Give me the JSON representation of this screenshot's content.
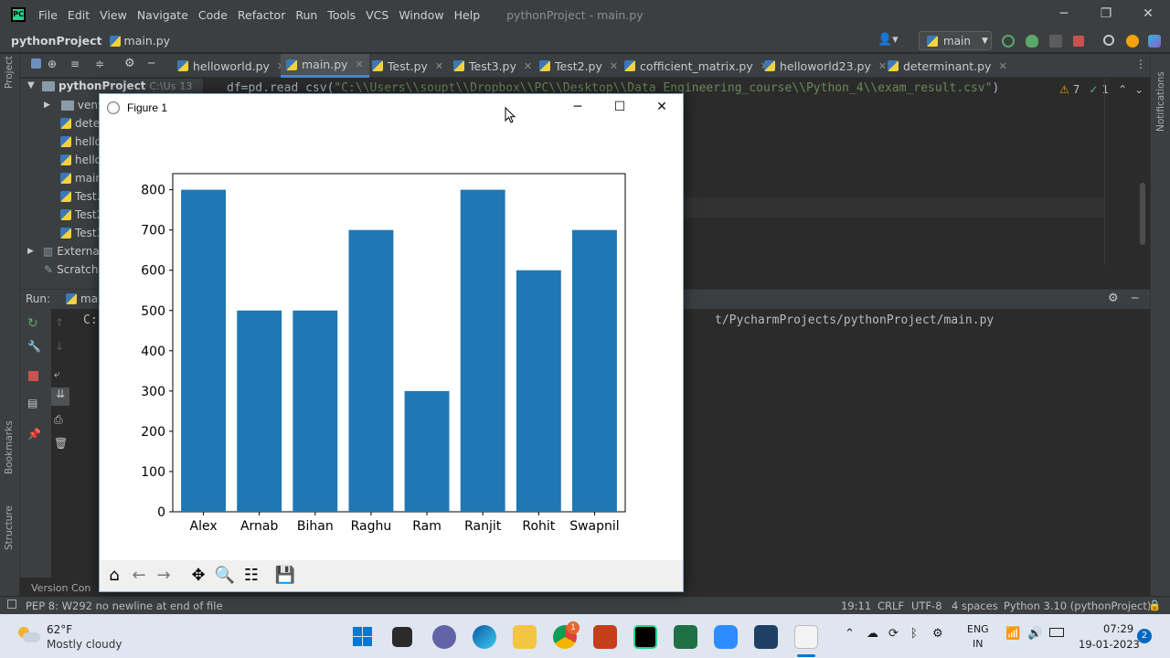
{
  "menubar": {
    "items": [
      "File",
      "Edit",
      "View",
      "Navigate",
      "Code",
      "Refactor",
      "Run",
      "Tools",
      "VCS",
      "Window",
      "Help"
    ],
    "window_title": "pythonProject - main.py"
  },
  "navbar": {
    "project": "pythonProject",
    "file": "main.py",
    "run_config": "main"
  },
  "tabs": [
    "helloworld.py",
    "main.py",
    "Test.py",
    "Test3.py",
    "Test2.py",
    "cofficient_matrix.py",
    "helloworld23.py",
    "determinant.py"
  ],
  "project_panel": {
    "root": "pythonProject",
    "root_path": "C:\\Us",
    "line_counter": "13",
    "items": [
      "venv",
      "dete",
      "hello",
      "hello",
      "main",
      "Test.",
      "Test2",
      "Test3",
      "External",
      "Scratche"
    ]
  },
  "editor": {
    "code_prefix": "df=pd.read_csv(",
    "code_string": "\"C:\\\\Users\\\\soupt\\\\Dropbox\\\\PC\\\\Desktop\\\\Data_Engineering_course\\\\Python_4\\\\exam_result.csv\"",
    "code_suffix": ")",
    "warnings": "7",
    "weak_warnings": "1"
  },
  "run": {
    "label": "Run:",
    "config": "mai",
    "console_prefix": "C:",
    "console_path": "t/PycharmProjects/pythonProject/main.py"
  },
  "left_strip_labels": [
    "Project",
    "Bookmarks",
    "Structure"
  ],
  "right_strip_label": "Notifications",
  "statusbar": {
    "version_control": "Version Con",
    "message": "PEP 8: W292 no newline at end of file",
    "position": "19:11",
    "line_sep": "CRLF",
    "encoding": "UTF-8",
    "indent": "4 spaces",
    "interpreter": "Python 3.10 (pythonProject)"
  },
  "figure": {
    "title": "Figure 1"
  },
  "chart_data": {
    "type": "bar",
    "categories": [
      "Alex",
      "Arnab",
      "Bihan",
      "Raghu",
      "Ram",
      "Ranjit",
      "Rohit",
      "Swapnil"
    ],
    "values": [
      800,
      500,
      500,
      700,
      300,
      800,
      600,
      700
    ],
    "yticks": [
      0,
      100,
      200,
      300,
      400,
      500,
      600,
      700,
      800
    ],
    "ylim": [
      0,
      840
    ],
    "title": "",
    "xlabel": "",
    "ylabel": "",
    "bar_color": "#1f77b4"
  },
  "taskbar": {
    "weather_temp": "62°F",
    "weather_desc": "Mostly cloudy",
    "lang_top": "ENG",
    "lang_bottom": "IN",
    "time": "07:29",
    "date": "19-01-2023",
    "notification_count": "2",
    "chrome_badge": "1"
  },
  "colors": {
    "accent": "#4a88c7",
    "ide_bg": "#2b2b2b",
    "panel": "#3c3f41"
  }
}
